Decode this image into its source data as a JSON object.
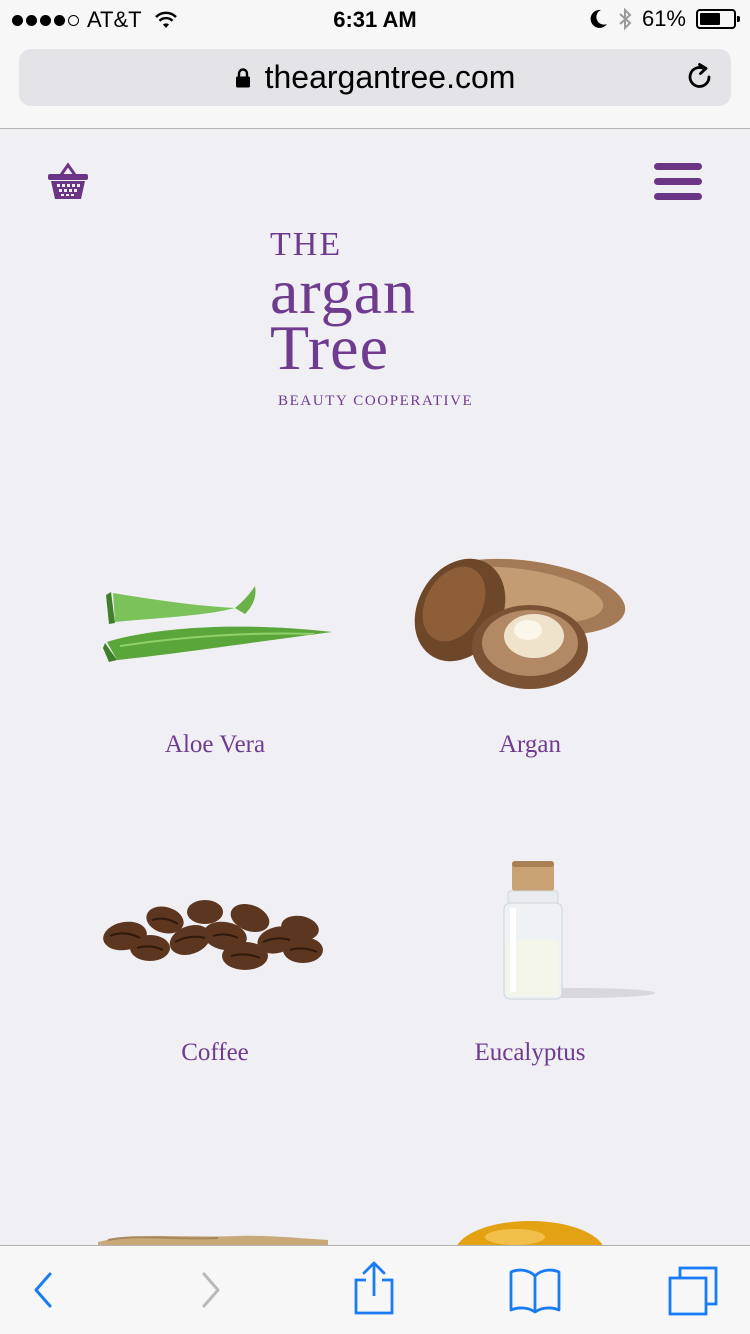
{
  "status": {
    "carrier": "AT&T",
    "time": "6:31 AM",
    "battery": "61%",
    "battery_level": 0.61,
    "signal_bars": 4
  },
  "browser": {
    "url": "theargantree.com",
    "icons": [
      "lock-icon",
      "reload-icon",
      "back-icon",
      "forward-icon",
      "share-icon",
      "bookmarks-icon",
      "tabs-icon"
    ]
  },
  "site": {
    "logo": {
      "the": "THE",
      "argan": "argan",
      "tree": "Tree",
      "tagline": "BEAUTY COOPERATIVE"
    },
    "icons": [
      "basket-icon",
      "hamburger-menu-icon"
    ],
    "accent_color": "#6f3b8e"
  },
  "products": [
    {
      "label": "Aloe Vera"
    },
    {
      "label": "Argan"
    },
    {
      "label": "Coffee"
    },
    {
      "label": "Eucalyptus"
    }
  ]
}
